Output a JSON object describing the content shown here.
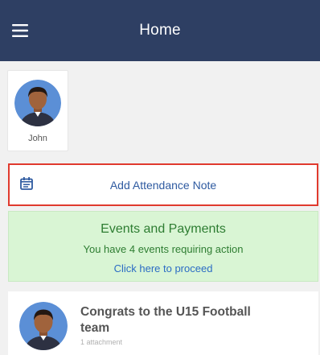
{
  "header": {
    "title": "Home",
    "menu_icon": "hamburger-menu-icon",
    "background": "#2e3f63"
  },
  "profile": {
    "name": "John",
    "avatar_icon": "person-avatar-icon"
  },
  "attendance": {
    "label": "Add Attendance Note",
    "icon": "calendar-icon",
    "highlight_color": "#e03a2e"
  },
  "events": {
    "title": "Events and Payments",
    "subtitle": "You have 4 events requiring action",
    "link": "Click here to proceed",
    "background": "#d9f5d4"
  },
  "news": {
    "title": "Congrats to the U15 Football team",
    "meta": "1 attachment",
    "avatar_icon": "person-avatar-icon"
  }
}
